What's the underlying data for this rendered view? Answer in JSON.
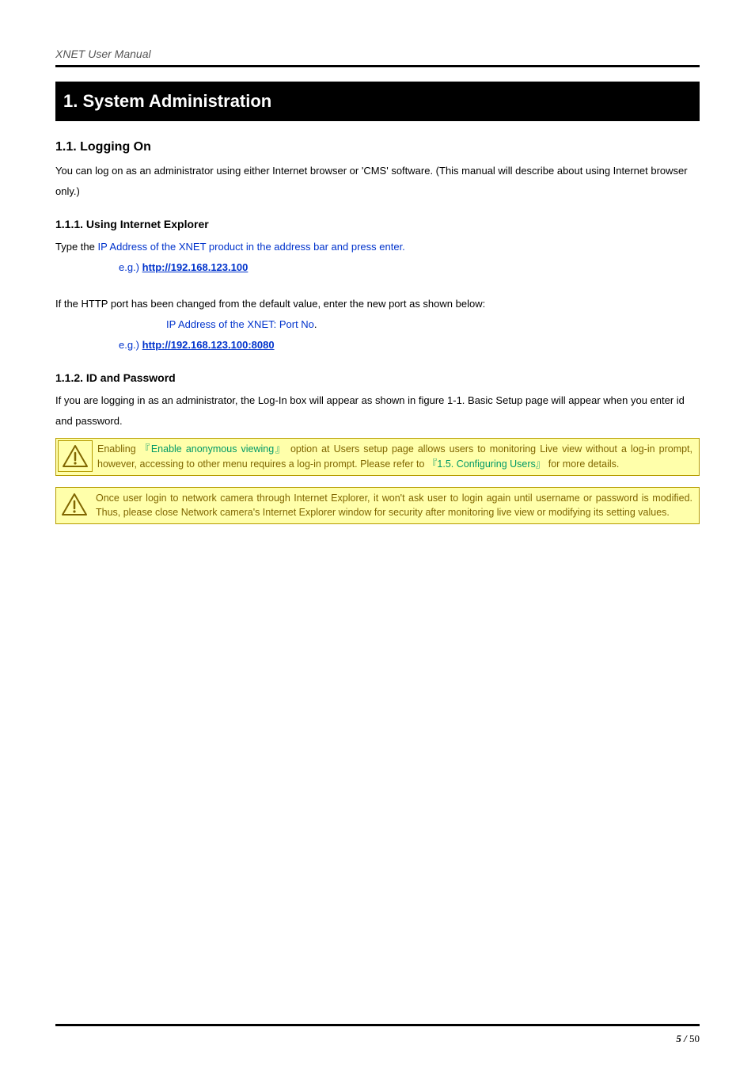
{
  "header": {
    "manual_title": "XNET User Manual"
  },
  "chapter": {
    "title": "1. System Administration"
  },
  "s11": {
    "heading": "1.1. Logging On",
    "para": "You can log on as an administrator using either Internet browser or 'CMS' software. (This manual will describe about using Internet browser only.)"
  },
  "s111": {
    "heading": "1.1.1. Using Internet Explorer",
    "line1_prefix": "Type the ",
    "line1_blue": "IP Address of the XNET product in the address bar and press enter.",
    "eg_label": "e.g.) ",
    "eg_url": "http://192.168.123.100",
    "port_line": "If the HTTP port has been changed from the default value, enter the new port as shown below:",
    "port_pattern": "IP Address of the XNET: Port No",
    "eg2_label": "e.g.) ",
    "eg2_url": "http://192.168.123.100:8080"
  },
  "s112": {
    "heading": "1.1.2. ID and Password",
    "para": "If you are logging in as an administrator, the Log-In box will appear as shown in figure 1-1. Basic Setup page will appear when you enter id and password."
  },
  "note1": {
    "pre": "Enabling ",
    "green1": "『Enable anonymous viewing』",
    "mid1": " option at Users setup page allows users to monitoring Live view without a log-in prompt, however, accessing to other menu requires a log-in prompt. Please refer to ",
    "green2": "『1.5. Configuring Users』",
    "tail": "  for more details."
  },
  "note2": {
    "text": "Once user login to network camera through Internet Explorer, it won't ask user to login again until username or password is modified. Thus, please close Network camera's Internet Explorer window for security after monitoring live view or modifying its setting values."
  },
  "footer": {
    "current": "5",
    "sep": " / ",
    "total": "50"
  }
}
